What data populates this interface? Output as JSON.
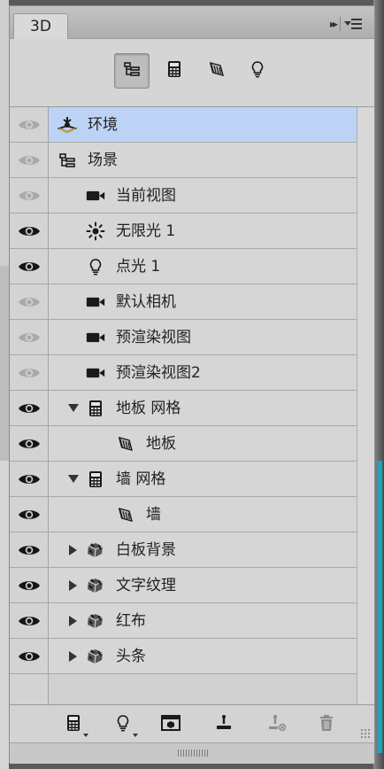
{
  "panel": {
    "tab_label": "3D",
    "collapse_glyph": "▸▸",
    "menu_icon": "panel-menu-icon"
  },
  "filters": [
    {
      "name": "scene-filter",
      "icon": "scene-tree-icon",
      "active": true
    },
    {
      "name": "meshes-filter",
      "icon": "mesh-icon",
      "active": false
    },
    {
      "name": "materials-filter",
      "icon": "material-icon",
      "active": false
    },
    {
      "name": "lights-filter",
      "icon": "light-bulb-icon",
      "active": false
    }
  ],
  "layers": [
    {
      "label": "环境",
      "visible_dim": true,
      "icon": "environment-icon",
      "indent": 0,
      "expander": "none",
      "selected": true
    },
    {
      "label": "场景",
      "visible_dim": true,
      "icon": "scene-tree-icon",
      "indent": 0,
      "expander": "none",
      "selected": false
    },
    {
      "label": "当前视图",
      "visible_dim": true,
      "icon": "camera-icon",
      "indent": 1,
      "expander": "none",
      "selected": false
    },
    {
      "label": "无限光 1",
      "visible_dim": false,
      "icon": "infinite-light-icon",
      "indent": 1,
      "expander": "none",
      "selected": false
    },
    {
      "label": "点光 1",
      "visible_dim": false,
      "icon": "light-bulb-icon",
      "indent": 1,
      "expander": "none",
      "selected": false
    },
    {
      "label": "默认相机",
      "visible_dim": true,
      "icon": "camera-icon",
      "indent": 1,
      "expander": "none",
      "selected": false
    },
    {
      "label": "预渲染视图",
      "visible_dim": true,
      "icon": "camera-icon",
      "indent": 1,
      "expander": "none",
      "selected": false
    },
    {
      "label": "预渲染视图2",
      "visible_dim": true,
      "icon": "camera-icon",
      "indent": 1,
      "expander": "none",
      "selected": false
    },
    {
      "label": "地板 网格",
      "visible_dim": false,
      "icon": "mesh-icon",
      "indent": 1,
      "expander": "open",
      "selected": false
    },
    {
      "label": "地板",
      "visible_dim": false,
      "icon": "material-icon",
      "indent": 2,
      "expander": "none",
      "selected": false
    },
    {
      "label": "墙 网格",
      "visible_dim": false,
      "icon": "mesh-icon",
      "indent": 1,
      "expander": "open",
      "selected": false
    },
    {
      "label": "墙",
      "visible_dim": false,
      "icon": "material-icon",
      "indent": 2,
      "expander": "none",
      "selected": false
    },
    {
      "label": "白板背景",
      "visible_dim": false,
      "icon": "3d-object-icon",
      "indent": 1,
      "expander": "closed",
      "selected": false
    },
    {
      "label": "文字纹理",
      "visible_dim": false,
      "icon": "3d-object-icon",
      "indent": 1,
      "expander": "closed",
      "selected": false
    },
    {
      "label": "红布",
      "visible_dim": false,
      "icon": "3d-object-icon",
      "indent": 1,
      "expander": "closed",
      "selected": false
    },
    {
      "label": "头条",
      "visible_dim": false,
      "icon": "3d-object-icon",
      "indent": 1,
      "expander": "closed",
      "selected": false
    }
  ],
  "bottom_tools": [
    {
      "name": "add-mesh-button",
      "icon": "mesh-icon",
      "dropdown": true,
      "enabled": true
    },
    {
      "name": "add-light-button",
      "icon": "light-bulb-icon",
      "dropdown": true,
      "enabled": true
    },
    {
      "name": "render-button",
      "icon": "render-icon",
      "dropdown": false,
      "enabled": true
    },
    {
      "name": "ground-button",
      "icon": "ground-plane-icon",
      "dropdown": false,
      "enabled": true
    },
    {
      "name": "remove-from-ground-button",
      "icon": "ground-remove-icon",
      "dropdown": false,
      "enabled": false
    },
    {
      "name": "delete-button",
      "icon": "trash-icon",
      "dropdown": false,
      "enabled": false
    }
  ],
  "colors": {
    "selection": "#bcd3f5",
    "panel_bg": "#d5d5d5"
  }
}
